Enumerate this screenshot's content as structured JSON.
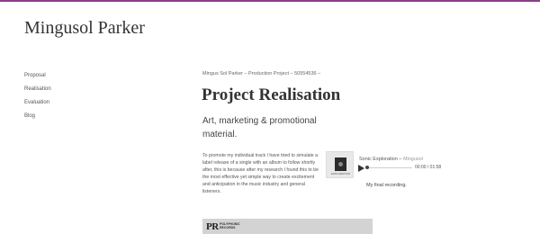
{
  "site": {
    "title": "Mingusol Parker"
  },
  "nav": {
    "items": [
      "Proposal",
      "Realisation",
      "Evaluation",
      "Blog"
    ]
  },
  "breadcrumb": "Mingus Sol Parker – Production Project – 50554536 –",
  "page": {
    "title": "Project Realisation",
    "subtitle": "Art, marketing & promotional material.",
    "body": "To promote my individual track I have tried to simulate a label release of a single with an album to follow shortly after, this is because after my research I found this to be the most effective yet simple way to create excitement and anticipation in the music industry and general listeners."
  },
  "player": {
    "cover_caption": "EXPLORATION",
    "track_title": "Sonic Exploration",
    "separator": "–",
    "artist": "Mingusol",
    "time": "00:00 / 01:58",
    "progress_fraction": 0.0,
    "caption": "My final recording."
  },
  "logo": {
    "mark": "PR",
    "line1": "POLYPHONIC",
    "line2": "RECORDS"
  },
  "colors": {
    "accent": "#8a3c8e",
    "logo_bg": "#d3d3d3"
  }
}
